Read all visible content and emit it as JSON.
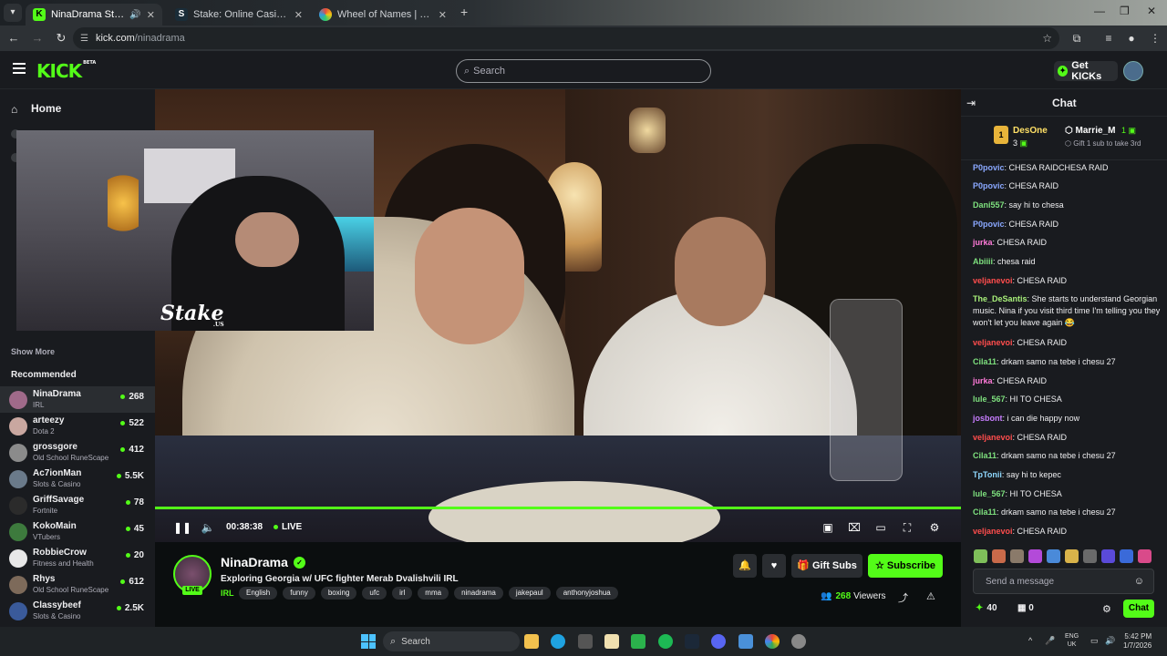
{
  "browser": {
    "tabs": [
      {
        "title": "NinaDrama Stream - Watch",
        "fav": "K",
        "active": true
      },
      {
        "title": "Stake: Online Casino & Sports",
        "fav": "S",
        "active": false
      },
      {
        "title": "Wheel of Names | Random name",
        "fav": "",
        "active": false
      }
    ],
    "url_domain": "kick.com",
    "url_path": "/ninadrama"
  },
  "header": {
    "logo": "KICK",
    "logo_badge": "BETA",
    "search_placeholder": "Search",
    "get_kicks": "Get KICKs"
  },
  "sidebar": {
    "home": "Home",
    "show_more": "Show More",
    "recommended_title": "Recommended",
    "channels": [
      {
        "name": "NinaDrama",
        "category": "IRL",
        "viewers": "268",
        "color": "#a06a8a"
      },
      {
        "name": "arteezy",
        "category": "Dota 2",
        "viewers": "522",
        "color": "#c9a7a0"
      },
      {
        "name": "grossgore",
        "category": "Old School RuneScape",
        "viewers": "412",
        "color": "#8b8b8b"
      },
      {
        "name": "Ac7ionMan",
        "category": "Slots & Casino",
        "viewers": "5.5K",
        "color": "#6a7a8a"
      },
      {
        "name": "GriffSavage",
        "category": "Fortnite",
        "viewers": "78",
        "color": "#2b2b2b"
      },
      {
        "name": "KokoMain",
        "category": "VTubers",
        "viewers": "45",
        "color": "#3d7a3d"
      },
      {
        "name": "RobbieCrow",
        "category": "Fitness and Health",
        "viewers": "20",
        "color": "#e8e8e8"
      },
      {
        "name": "Rhys",
        "category": "Old School RuneScape",
        "viewers": "612",
        "color": "#7d6a5a"
      },
      {
        "name": "Classybeef",
        "category": "Slots & Casino",
        "viewers": "2.5K",
        "color": "#3a5a9a"
      }
    ]
  },
  "player": {
    "overlay_logo": "Stake",
    "overlay_sub": ".US",
    "time": "00:38:38",
    "live": "LIVE"
  },
  "stream": {
    "streamer": "NinaDrama",
    "live_badge": "LIVE",
    "title": "Exploring Georgia w/ UFC fighter Merab Dvalishvili IRL",
    "category": "IRL",
    "tags": [
      "English",
      "funny",
      "boxing",
      "ufc",
      "irl",
      "mma",
      "ninadrama",
      "jakepaul",
      "anthonyjoshua"
    ],
    "gift_subs": "Gift Subs",
    "subscribe": "Subscribe",
    "viewers": "268",
    "viewers_label": "Viewers"
  },
  "chat": {
    "title": "Chat",
    "pinned": {
      "rank": "1",
      "user1": "DesOne",
      "user1_count": "3",
      "user2": "Marrie_M",
      "user2_count": "1",
      "subtext": "Gift 1 sub to take 3rd"
    },
    "messages": [
      {
        "user": "P0povic",
        "text": "CHESA RAIDCHESA RAID",
        "color": "#8aa8ff"
      },
      {
        "user": "P0povic",
        "text": "CHESA RAID",
        "color": "#8aa8ff"
      },
      {
        "user": "Dani557",
        "text": "say hi to chesa",
        "color": "#7ee07e"
      },
      {
        "user": "P0povic",
        "text": "CHESA RAID",
        "color": "#8aa8ff"
      },
      {
        "user": "jurka",
        "text": "CHESA RAID",
        "color": "#ff7ad9"
      },
      {
        "user": "Abiiii",
        "text": "chesa raid",
        "color": "#7ee07e"
      },
      {
        "user": "veljanevoi",
        "text": "CHESA RAID",
        "color": "#ff4d4d"
      },
      {
        "user": "The_DeSantis",
        "text": "She starts to understand Georgian music. Nina if you visit third time I'm telling you they won't let you leave again 😂",
        "color": "#a8f07a"
      },
      {
        "user": "veljanevoi",
        "text": "CHESA RAID",
        "color": "#ff4d4d"
      },
      {
        "user": "Cila11",
        "text": "drkam samo na tebe i chesu 27",
        "color": "#7ee07e"
      },
      {
        "user": "jurka",
        "text": "CHESA RAID",
        "color": "#ff7ad9"
      },
      {
        "user": "lule_567",
        "text": "HI TO CHESA",
        "color": "#7ee07e"
      },
      {
        "user": "josbont",
        "text": "i can die happy now",
        "color": "#c77dff"
      },
      {
        "user": "veljanevoi",
        "text": "CHESA RAID",
        "color": "#ff4d4d"
      },
      {
        "user": "Cila11",
        "text": "drkam samo na tebe i chesu 27",
        "color": "#7ee07e"
      },
      {
        "user": "TpTonii",
        "text": "say hi to kepec",
        "color": "#8fd8ff"
      },
      {
        "user": "lule_567",
        "text": "HI TO CHESA",
        "color": "#7ee07e"
      },
      {
        "user": "Cila11",
        "text": "drkam samo na tebe i chesu 27",
        "color": "#7ee07e"
      },
      {
        "user": "veljanevoi",
        "text": "CHESA RAID",
        "color": "#ff4d4d"
      }
    ],
    "input_placeholder": "Send a message",
    "kicks": "40",
    "gifts": "0",
    "send": "Chat"
  },
  "taskbar": {
    "search": "Search",
    "lang1": "ENG",
    "lang2": "UK",
    "time": "5:42 PM",
    "date": "1/7/2026"
  },
  "colors": {
    "accent": "#53fc18",
    "background": "#0b0e0f",
    "panel": "#191b1f"
  }
}
